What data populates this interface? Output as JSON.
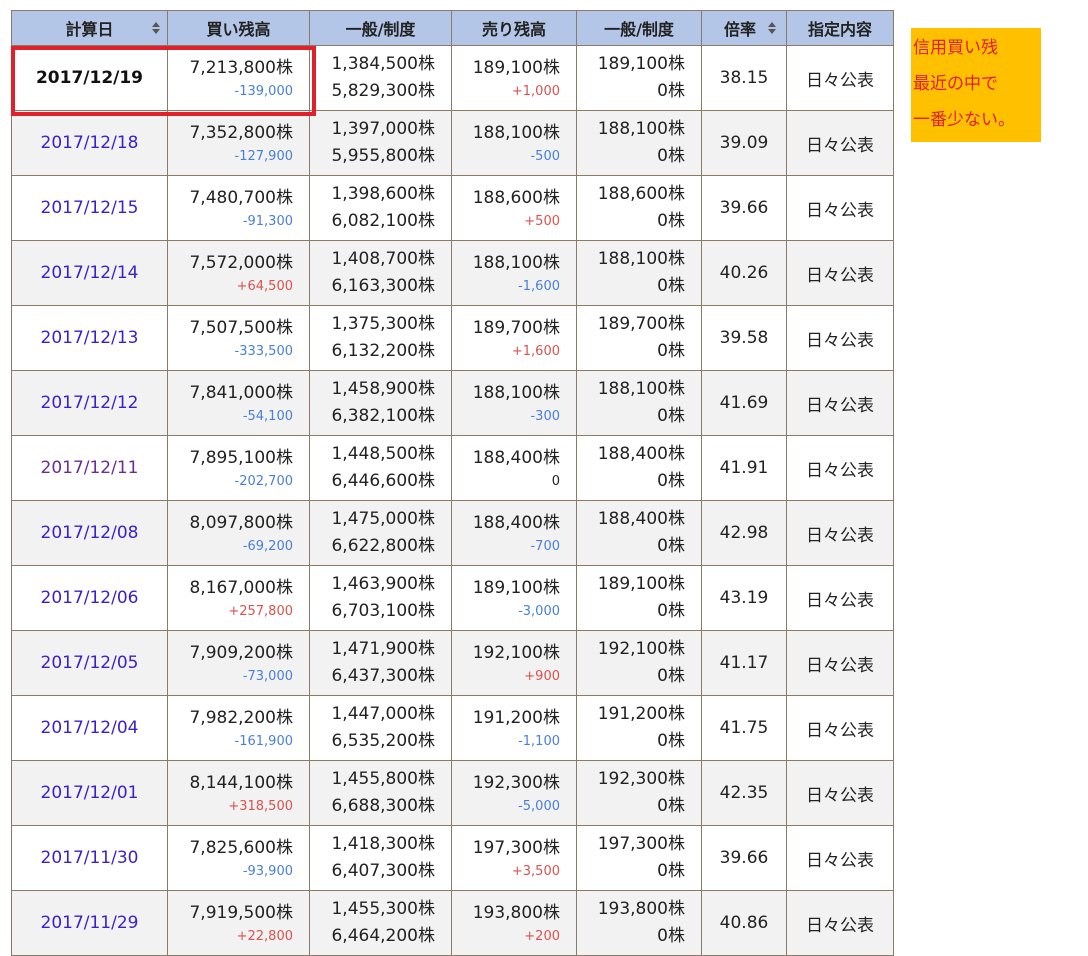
{
  "headers": {
    "date": "計算日",
    "buy": "買い残高",
    "buy_gen": "一般/制度",
    "sell": "売り残高",
    "sell_gen": "一般/制度",
    "ratio": "倍率",
    "designation": "指定内容"
  },
  "note": {
    "line1": "信用買い残",
    "line2": "最近の中で",
    "line3": "一番少ない。"
  },
  "colors": {
    "header_bg": "#b4c6e7",
    "negative": "#4a7fd9",
    "positive": "#d9534f",
    "note_bg": "#ffc000",
    "note_text": "#e0202a",
    "highlight_border": "#e0202a",
    "date_link": "#3c1fc9"
  },
  "rows": [
    {
      "date": "2017/12/19",
      "buy": "7,213,800株",
      "buy_chg": "-139,000",
      "buy_chg_sign": "neg",
      "buy_general": "1,384,500株",
      "buy_system": "5,829,300株",
      "sell": "189,100株",
      "sell_chg": "+1,000",
      "sell_chg_sign": "pos",
      "sell_general": "189,100株",
      "sell_system": "0株",
      "ratio": "38.15",
      "designation": "日々公表"
    },
    {
      "date": "2017/12/18",
      "buy": "7,352,800株",
      "buy_chg": "-127,900",
      "buy_chg_sign": "neg",
      "buy_general": "1,397,000株",
      "buy_system": "5,955,800株",
      "sell": "188,100株",
      "sell_chg": "-500",
      "sell_chg_sign": "neg",
      "sell_general": "188,100株",
      "sell_system": "0株",
      "ratio": "39.09",
      "designation": "日々公表"
    },
    {
      "date": "2017/12/15",
      "buy": "7,480,700株",
      "buy_chg": "-91,300",
      "buy_chg_sign": "neg",
      "buy_general": "1,398,600株",
      "buy_system": "6,082,100株",
      "sell": "188,600株",
      "sell_chg": "+500",
      "sell_chg_sign": "pos",
      "sell_general": "188,600株",
      "sell_system": "0株",
      "ratio": "39.66",
      "designation": "日々公表"
    },
    {
      "date": "2017/12/14",
      "buy": "7,572,000株",
      "buy_chg": "+64,500",
      "buy_chg_sign": "pos",
      "buy_general": "1,408,700株",
      "buy_system": "6,163,300株",
      "sell": "188,100株",
      "sell_chg": "-1,600",
      "sell_chg_sign": "neg",
      "sell_general": "188,100株",
      "sell_system": "0株",
      "ratio": "40.26",
      "designation": "日々公表"
    },
    {
      "date": "2017/12/13",
      "buy": "7,507,500株",
      "buy_chg": "-333,500",
      "buy_chg_sign": "neg",
      "buy_general": "1,375,300株",
      "buy_system": "6,132,200株",
      "sell": "189,700株",
      "sell_chg": "+1,600",
      "sell_chg_sign": "pos",
      "sell_general": "189,700株",
      "sell_system": "0株",
      "ratio": "39.58",
      "designation": "日々公表"
    },
    {
      "date": "2017/12/12",
      "buy": "7,841,000株",
      "buy_chg": "-54,100",
      "buy_chg_sign": "neg",
      "buy_general": "1,458,900株",
      "buy_system": "6,382,100株",
      "sell": "188,100株",
      "sell_chg": "-300",
      "sell_chg_sign": "neg",
      "sell_general": "188,100株",
      "sell_system": "0株",
      "ratio": "41.69",
      "designation": "日々公表"
    },
    {
      "date": "2017/12/11",
      "buy": "7,895,100株",
      "buy_chg": "-202,700",
      "buy_chg_sign": "neg",
      "buy_general": "1,448,500株",
      "buy_system": "6,446,600株",
      "sell": "188,400株",
      "sell_chg": "0",
      "sell_chg_sign": "zero",
      "sell_general": "188,400株",
      "sell_system": "0株",
      "ratio": "41.91",
      "designation": "日々公表"
    },
    {
      "date": "2017/12/08",
      "buy": "8,097,800株",
      "buy_chg": "-69,200",
      "buy_chg_sign": "neg",
      "buy_general": "1,475,000株",
      "buy_system": "6,622,800株",
      "sell": "188,400株",
      "sell_chg": "-700",
      "sell_chg_sign": "neg",
      "sell_general": "188,400株",
      "sell_system": "0株",
      "ratio": "42.98",
      "designation": "日々公表"
    },
    {
      "date": "2017/12/06",
      "buy": "8,167,000株",
      "buy_chg": "+257,800",
      "buy_chg_sign": "pos",
      "buy_general": "1,463,900株",
      "buy_system": "6,703,100株",
      "sell": "189,100株",
      "sell_chg": "-3,000",
      "sell_chg_sign": "neg",
      "sell_general": "189,100株",
      "sell_system": "0株",
      "ratio": "43.19",
      "designation": "日々公表"
    },
    {
      "date": "2017/12/05",
      "buy": "7,909,200株",
      "buy_chg": "-73,000",
      "buy_chg_sign": "neg",
      "buy_general": "1,471,900株",
      "buy_system": "6,437,300株",
      "sell": "192,100株",
      "sell_chg": "+900",
      "sell_chg_sign": "pos",
      "sell_general": "192,100株",
      "sell_system": "0株",
      "ratio": "41.17",
      "designation": "日々公表"
    },
    {
      "date": "2017/12/04",
      "buy": "7,982,200株",
      "buy_chg": "-161,900",
      "buy_chg_sign": "neg",
      "buy_general": "1,447,000株",
      "buy_system": "6,535,200株",
      "sell": "191,200株",
      "sell_chg": "-1,100",
      "sell_chg_sign": "neg",
      "sell_general": "191,200株",
      "sell_system": "0株",
      "ratio": "41.75",
      "designation": "日々公表"
    },
    {
      "date": "2017/12/01",
      "buy": "8,144,100株",
      "buy_chg": "+318,500",
      "buy_chg_sign": "pos",
      "buy_general": "1,455,800株",
      "buy_system": "6,688,300株",
      "sell": "192,300株",
      "sell_chg": "-5,000",
      "sell_chg_sign": "neg",
      "sell_general": "192,300株",
      "sell_system": "0株",
      "ratio": "42.35",
      "designation": "日々公表"
    },
    {
      "date": "2017/11/30",
      "buy": "7,825,600株",
      "buy_chg": "-93,900",
      "buy_chg_sign": "neg",
      "buy_general": "1,418,300株",
      "buy_system": "6,407,300株",
      "sell": "197,300株",
      "sell_chg": "+3,500",
      "sell_chg_sign": "pos",
      "sell_general": "197,300株",
      "sell_system": "0株",
      "ratio": "39.66",
      "designation": "日々公表"
    },
    {
      "date": "2017/11/29",
      "buy": "7,919,500株",
      "buy_chg": "+22,800",
      "buy_chg_sign": "pos",
      "buy_general": "1,455,300株",
      "buy_system": "6,464,200株",
      "sell": "193,800株",
      "sell_chg": "+200",
      "sell_chg_sign": "pos",
      "sell_general": "193,800株",
      "sell_system": "0株",
      "ratio": "40.86",
      "designation": "日々公表"
    }
  ]
}
